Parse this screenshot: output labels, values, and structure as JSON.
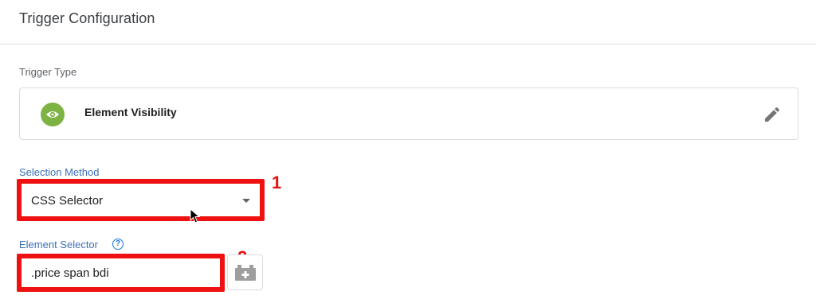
{
  "header": {
    "title": "Trigger Configuration"
  },
  "trigger_type": {
    "label": "Trigger Type",
    "name": "Element Visibility",
    "icon": "eye-icon",
    "icon_color": "#7cb342",
    "edit_icon": "pencil-icon"
  },
  "selection_method": {
    "label": "Selection Method",
    "value": "CSS Selector",
    "callout": "1"
  },
  "element_selector": {
    "label": "Element Selector",
    "help": "?",
    "value": ".price span bdi",
    "callout": "2",
    "variable_icon": "variable-picker-icon"
  },
  "colors": {
    "highlight": "#ef1111",
    "label_blue": "#3b6fb6"
  }
}
